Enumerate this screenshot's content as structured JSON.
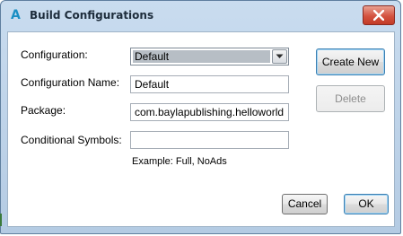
{
  "window": {
    "title": "Build Configurations",
    "app_icon": "A"
  },
  "form": {
    "configuration_label": "Configuration:",
    "configuration_value": "Default",
    "configuration_name_label": "Configuration Name:",
    "configuration_name_value": "Default",
    "package_label": "Package:",
    "package_value": "com.baylapublishing.helloworld",
    "conditional_symbols_label": "Conditional Symbols:",
    "conditional_symbols_value": "",
    "conditional_symbols_hint": "Example: Full, NoAds"
  },
  "buttons": {
    "create_new": "Create New",
    "delete": "Delete",
    "cancel": "Cancel",
    "ok": "OK"
  },
  "colors": {
    "titlebar": "#b4cbe3",
    "close_button": "#c94a36",
    "combo_selection": "#b7bec5",
    "default_button_border": "#3c7fb1"
  }
}
